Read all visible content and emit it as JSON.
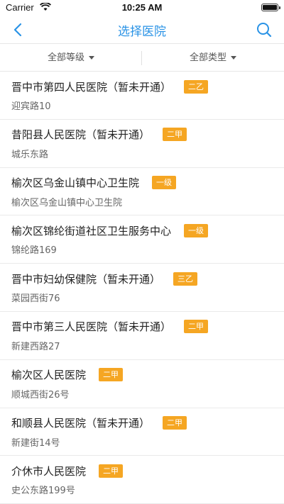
{
  "status_bar": {
    "carrier": "Carrier",
    "time": "10:25 AM"
  },
  "nav": {
    "title": "选择医院"
  },
  "filters": [
    {
      "label": "全部等级"
    },
    {
      "label": "全部类型"
    }
  ],
  "hospitals": [
    {
      "name": "晋中市第四人民医院（暂未开通）",
      "level": "二乙",
      "address": "迎宾路10"
    },
    {
      "name": "昔阳县人民医院（暂未开通）",
      "level": "二甲",
      "address": "城乐东路"
    },
    {
      "name": "榆次区乌金山镇中心卫生院",
      "level": "一级",
      "address": "榆次区乌金山镇中心卫生院"
    },
    {
      "name": "榆次区锦纶街道社区卫生服务中心",
      "level": "一级",
      "address": "锦纶路169"
    },
    {
      "name": "晋中市妇幼保健院（暂未开通）",
      "level": "三乙",
      "address": "菜园西街76"
    },
    {
      "name": "晋中市第三人民医院（暂未开通）",
      "level": "二甲",
      "address": "新建西路27"
    },
    {
      "name": "榆次区人民医院",
      "level": "二甲",
      "address": "顺城西街26号"
    },
    {
      "name": "和顺县人民医院（暂未开通）",
      "level": "二甲",
      "address": "新建街14号"
    },
    {
      "name": "介休市人民医院",
      "level": "二甲",
      "address": "史公东路199号"
    }
  ]
}
